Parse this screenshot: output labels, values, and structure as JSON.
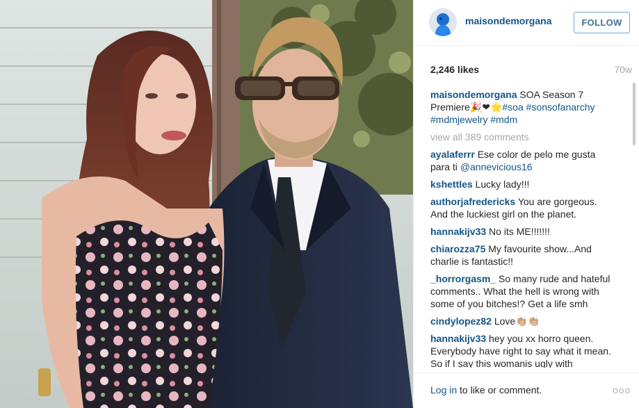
{
  "post": {
    "username": "maisondemorgana",
    "follow_label": "FOLLOW",
    "likes": "2,246 likes",
    "age": "70w"
  },
  "caption": {
    "username": "maisondemorgana",
    "text": "SOA Season 7 Premiere",
    "emoji": "🎉❤🌟",
    "hashtags": [
      "#soa",
      "#sonsofanarchy",
      "#mdmjewelry",
      "#mdm"
    ]
  },
  "view_all": "view all 389 comments",
  "comments": [
    {
      "user": "ayalaferrr",
      "text": "Ese color de pelo me gusta para ti",
      "mention": "@annevicious16"
    },
    {
      "user": "kshettles",
      "text": "Lucky lady!!!"
    },
    {
      "user": "authorjafredericks",
      "text": "You are gorgeous. And the luckiest girl on the planet."
    },
    {
      "user": "hannakijv33",
      "text": "No its ME!!!!!!!"
    },
    {
      "user": "chiarozza75",
      "text": "My favourite show...And charlie is fantastic!!"
    },
    {
      "user": "_horrorgasm_",
      "text": "So many rude and hateful comments.. What the hell is wrong with some of you bitches!? Get a life smh"
    },
    {
      "user": "cindylopez82",
      "text": "Love👏🏼👏🏼"
    },
    {
      "user": "hannakijv33",
      "text": "hey you xx horro queen. Everybody have right to say what it mean. So if I say this womanis ugly with"
    }
  ],
  "footer": {
    "login_link": "Log in",
    "login_rest": " to like or comment.",
    "more": "ooo"
  },
  "icons": {
    "avatar": "profile-avatar-icon",
    "more": "more-options-icon"
  },
  "colors": {
    "link": "#125688",
    "follow_border": "#70a6cf",
    "muted": "#a5a7aa"
  }
}
